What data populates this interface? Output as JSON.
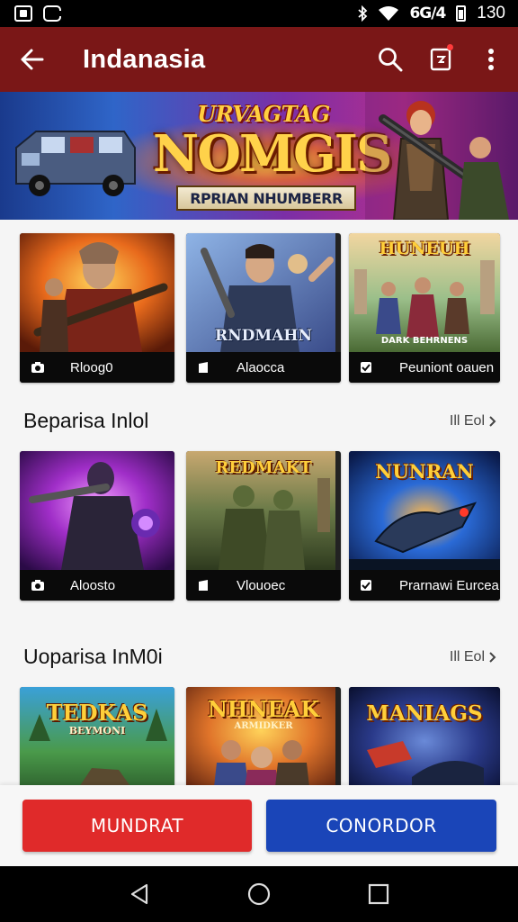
{
  "status_bar": {
    "signal_text": "6G/4",
    "time": "130"
  },
  "app_bar": {
    "title": "Indanasia",
    "back_icon": "arrow-left-icon",
    "search_icon": "search-icon",
    "inbox_icon": "notification-box-icon",
    "more_icon": "more-vertical-icon"
  },
  "banner": {
    "top_text": "URVAGTAG",
    "title": "NOMGIS",
    "ribbon": "RPRIAN NHUMBERR"
  },
  "featured": [
    {
      "caption": "Rloog0",
      "art_label": "",
      "icon": "camera-icon"
    },
    {
      "caption": "Alaocca",
      "art_label": "RNDMAHN",
      "icon": "tablet-icon"
    },
    {
      "caption": "Peuniont oauen",
      "art_label": "HUNEUH",
      "art_sub": "DARK BEHRNENS",
      "icon": "check-box-icon"
    }
  ],
  "section1": {
    "title": "Beparisa Inlol",
    "more": "Ill Eol"
  },
  "section1_cards": [
    {
      "caption": "Aloosto",
      "art_label": "",
      "icon": "camera-icon"
    },
    {
      "caption": "Vlouoec",
      "art_label": "REDMAKT",
      "icon": "tablet-icon"
    },
    {
      "caption": "Prarnawi Eurcea",
      "art_label": "NUNRAN",
      "icon": "check-box-icon"
    }
  ],
  "section2": {
    "title": "Uoparisa InM0i",
    "more": "Ill Eol"
  },
  "section2_cards": [
    {
      "art_label": "TEDKAS",
      "art_sub": "BEYMONI"
    },
    {
      "art_label": "NHNEAK",
      "art_sub": "ARMIDKER"
    },
    {
      "art_label": "MANIAGS"
    }
  ],
  "actions": {
    "primary": "MUNDRAT",
    "secondary": "CONORDOR"
  },
  "colors": {
    "app_bar": "#7a1717",
    "primary_button": "#e02a2a",
    "secondary_button": "#1a45b8"
  }
}
